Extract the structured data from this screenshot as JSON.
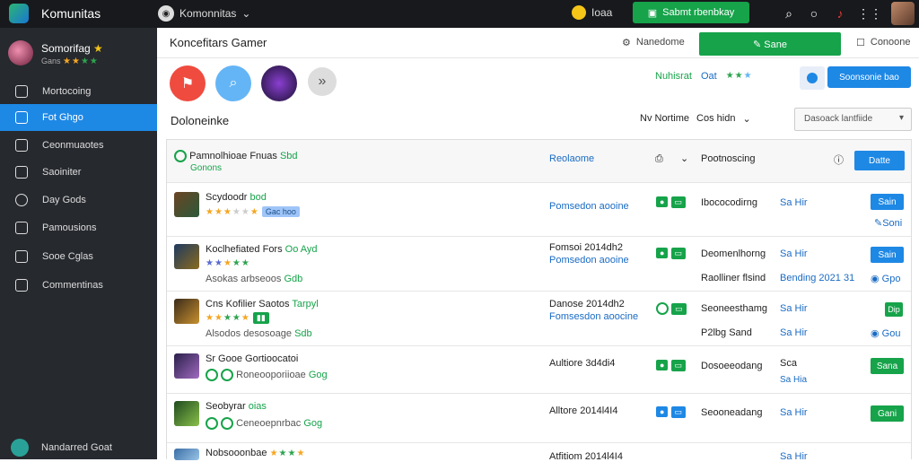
{
  "topbar": {
    "app_title": "Komunitas",
    "workspace_label": "Komonnitas",
    "coin_label": "Ioaa",
    "action_button_label": "Sabmt rbenbkay"
  },
  "sidebar": {
    "user_name": "Somorifag",
    "user_sub": "Gans",
    "items": [
      {
        "label": "Mortocoing",
        "icon": "settings-icon"
      },
      {
        "label": "Fot Ghgo",
        "icon": "home-icon"
      },
      {
        "label": "Ceonmuaotes",
        "icon": "monitor-icon"
      },
      {
        "label": "Saoiniter",
        "icon": "chat-icon"
      },
      {
        "label": "Day Gods",
        "icon": "globe-icon"
      },
      {
        "label": "Pamousions",
        "icon": "share-icon"
      },
      {
        "label": "Sooe Cglas",
        "icon": "document-icon"
      },
      {
        "label": "Commentinas",
        "icon": "puzzle-icon"
      }
    ],
    "footer_label": "Nandarred Goat"
  },
  "header": {
    "title": "Koncefitars Gamer",
    "link_a": "Nanedome",
    "primary_button": "Sane",
    "link_b": "Conoone"
  },
  "filters": {
    "rating_label": "Nuhisrat",
    "rating_value": "Oat",
    "blue_button": "Soonsonie bao"
  },
  "section": {
    "title": "Doloneinke",
    "sort_label": "Nv Nortime",
    "sort_value": "Cos hidn",
    "select_value": "Dasoack lantfiide"
  },
  "table_head": {
    "name": "Pamnolhioae Fnuas",
    "badge": "Sbd",
    "sub": "Gonons",
    "col_a": "Reolaome",
    "col_b": "Pootnoscing",
    "button": "Datte"
  },
  "rows": [
    {
      "title": "Scydoodr",
      "badge": "bod",
      "tag": "Gac hoo",
      "col_a": "Pomsedon aooine",
      "col_b": "Ibococodirng",
      "col_c": "Sa Hir",
      "btn": "Sain",
      "extra": "Soni"
    },
    {
      "title": "Koclhefiated Fors",
      "badge": "Oo Ayd",
      "sub": "Asokas arbseoos",
      "sub2": "Gdb",
      "date": "Fomsoi 2014dh2",
      "col_a": "Pomsedon aooine",
      "col_b": "Deomenlhorng",
      "col_b2": "Raolliner flsind",
      "col_c": "Sa Hir",
      "col_c2": "Bending 2021 31",
      "btn": "Sain",
      "extra": "Gpo"
    },
    {
      "title": "Cns Kofilier Saotos",
      "badge": "Tarpyl",
      "sub": "Alsodos desosoage",
      "sub2": "Sdb",
      "date": "Danose 2014dh2",
      "col_a": "Fomsesdon aoocine",
      "col_b": "Seoneesthamg",
      "col_b2": "P2lbg Sand",
      "col_c": "Sa Hir",
      "col_c2": "Sa Hir",
      "btn": "Dip",
      "extra": "Gou"
    },
    {
      "title": "Sr Gooe Gortioocatoi",
      "sub": "Roneooporiioae",
      "sub2": "Gog",
      "date": "Aultiore 3d4di4",
      "col_b": "Dosoeeodang",
      "col_c": "Sca",
      "col_c2": "Sa Hia",
      "btn": "Sana"
    },
    {
      "title": "Seobyrar",
      "badge": "oias",
      "sub": "Ceneoepnrbac",
      "sub2": "Gog",
      "date": "Alltore 2014l4I4",
      "col_b": "Seooneadang",
      "col_c": "Sa Hir",
      "btn": "Gani"
    },
    {
      "title": "Nobsooonbae",
      "date": "Atfitiom 2014l4I4",
      "col_c": "Sa Hir"
    }
  ]
}
